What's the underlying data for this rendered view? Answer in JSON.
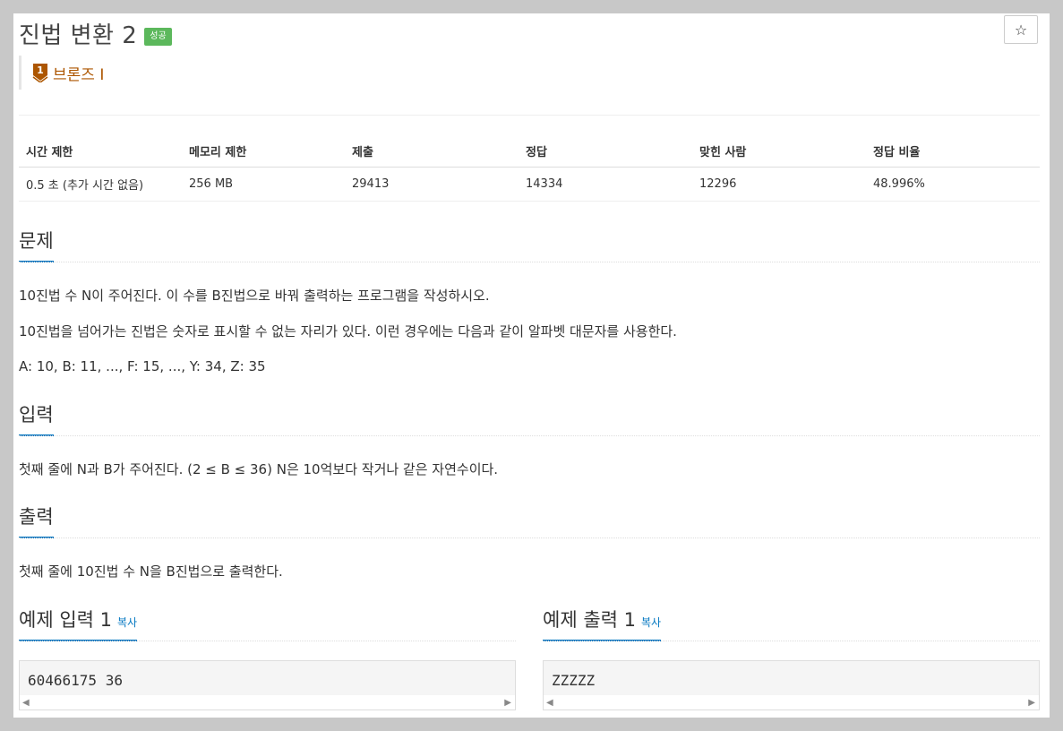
{
  "problem": {
    "title": "진법 변환 2",
    "status_badge": "성공",
    "star_icon": "☆",
    "tier": {
      "label": "브론즈 I",
      "color": "#ad5600",
      "icon": "bronze-1-icon"
    }
  },
  "info_table": {
    "headers": [
      "시간 제한",
      "메모리 제한",
      "제출",
      "정답",
      "맞힌 사람",
      "정답 비율"
    ],
    "values": [
      "0.5 초 (추가 시간 없음)",
      "256 MB",
      "29413",
      "14334",
      "12296",
      "48.996%"
    ]
  },
  "sections": {
    "description": {
      "title": "문제",
      "paragraphs": [
        "10진법 수 N이 주어진다. 이 수를 B진법으로 바꿔 출력하는 프로그램을 작성하시오.",
        "10진법을 넘어가는 진법은 숫자로 표시할 수 없는 자리가 있다. 이런 경우에는 다음과 같이 알파벳 대문자를 사용한다.",
        "A: 10, B: 11, ..., F: 15, ..., Y: 34, Z: 35"
      ]
    },
    "input": {
      "title": "입력",
      "text": "첫째 줄에 N과 B가 주어진다. (2 ≤ B ≤ 36) N은 10억보다 작거나 같은 자연수이다."
    },
    "output": {
      "title": "출력",
      "text": "첫째 줄에 10진법 수 N을 B진법으로 출력한다."
    },
    "sample_input": {
      "title": "예제 입력 1",
      "copy_label": "복사",
      "content": "60466175 36"
    },
    "sample_output": {
      "title": "예제 출력 1",
      "copy_label": "복사",
      "content": "ZZZZZ"
    }
  },
  "colors": {
    "accent": "#0076c0",
    "success": "#5cb85c",
    "bronze": "#ad5600"
  }
}
